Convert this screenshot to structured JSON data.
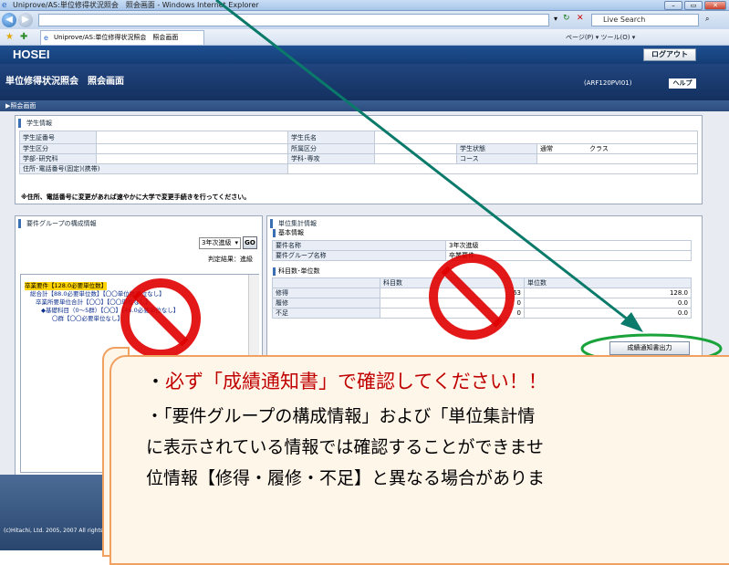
{
  "window": {
    "title": "Uniprove/AS:単位修得状況照会　照会画面 - Windows Internet Explorer",
    "search_placeholder": "Live Search",
    "tab_title": "Uniprove/AS:単位修得状況照会　照会画面",
    "toolbar_menu": "ページ(P) ▾  ツール(O) ▾"
  },
  "app": {
    "logo": "HOSEI",
    "logout_label": "ログアウト",
    "page_title": "単位修得状況照会　照会画面",
    "screen_id": "(ARF120PVI01)",
    "help_label": "ヘルプ",
    "breadcrumb": "▶照会画面"
  },
  "student_info": {
    "section_title": "学生情報",
    "student_id_label": "学生証番号",
    "student_name_label": "学生氏名",
    "student_type_label": "学生区分",
    "affiliation_type_label": "所属区分",
    "status_label": "学生状態",
    "status_value": "通常",
    "class_label": "クラス",
    "faculty_label": "学部･研究科",
    "department_label": "学科･専攻",
    "course_label": "コース",
    "address_label": "住所･電話番号(固定)(携帯)",
    "notice": "※住所、電話番号に変更があれば速やかに大学で変更手続きを行ってください。"
  },
  "requirement_group": {
    "section_title": "要件グループの構成情報",
    "select_value": "3年次進級",
    "go_label": "GO",
    "judge_result": "判定結果：進級",
    "tree": [
      "卒業要件【128.0必要単位数】",
      "総合計【88.0必要単位数】【〇〇単位数単位なし】",
      "卒業所要単位合計【〇〇】【〇〇単位なし】",
      "◆基礎科目（0～5群）【〇〇】【46.0必要単位なし】",
      "〇群【〇〇必要単位なし】"
    ]
  },
  "summary": {
    "section_title": "単位集計情報",
    "basic_title": "基本情報",
    "req_name_label": "要件名称",
    "req_name_value": "3年次進級",
    "group_name_label": "要件グループ名称",
    "group_name_value": "卒業要件",
    "count_title": "科目数･単位数",
    "col_subjects": "科目数",
    "col_credits": "単位数",
    "rows": [
      {
        "label": "修得",
        "subjects": "63",
        "credits": "128.0"
      },
      {
        "label": "履修",
        "subjects": "0",
        "credits": "0.0"
      },
      {
        "label": "不足",
        "subjects": "0",
        "credits": "0.0"
      }
    ],
    "print_button": "成績通知書出力"
  },
  "footer": {
    "copyright": "(c)Hitachi, Ltd. 2005, 2007 All rights"
  },
  "callout": {
    "line1_prefix": "・",
    "line1_emphasis": "必ず「成績通知書」で確認してください！！",
    "line2": "・「要件グループの構成情報」および「単位集計情",
    "line3": "に表示されている情報では確認することができませ",
    "line4": "位情報【修得・履修・不足】と異なる場合がありま"
  },
  "colors": {
    "header_navy": "#1b3d73",
    "prohibit_red": "#e00000",
    "arrow_teal": "#0a7a6a",
    "highlight_green": "#1aa33a",
    "callout_border": "#f0a060"
  }
}
